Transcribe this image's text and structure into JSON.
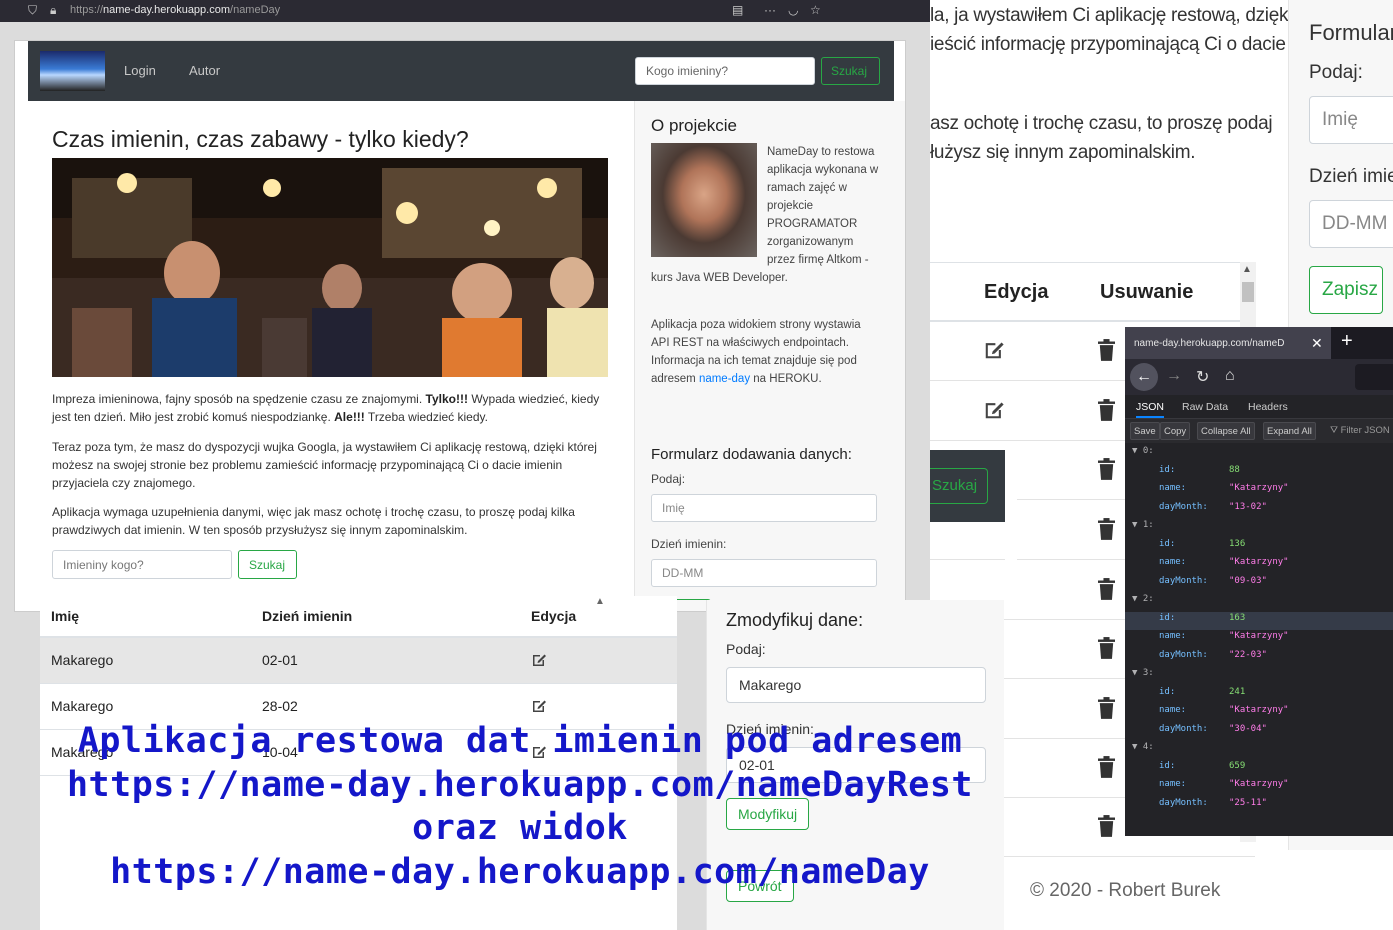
{
  "browser": {
    "url_prefix": "https://",
    "url_domain": "name-day.herokuapp.com",
    "url_path": "/nameDay",
    "icons": [
      "shield-icon",
      "lock-icon",
      "reader-icon",
      "more-icon",
      "pocket-icon",
      "bookmark-star-icon"
    ]
  },
  "navbar": {
    "links": [
      "Login",
      "Autor"
    ],
    "search_placeholder": "Kogo imieniny?",
    "search_button": "Szukaj"
  },
  "content": {
    "title": "Czas imienin, czas zabawy - tylko kiedy?",
    "p1_a": "Impreza imieninowa, fajny sposób na spędzenie czasu ze znajomymi. ",
    "p1_b": "Tylko!!!",
    "p1_c": " Wypada wiedzieć, kiedy jest ten dzień. Miło jest zrobić komuś niespodziankę. ",
    "p1_d": "Ale!!!",
    "p1_e": " Trzeba wiedzieć kiedy.",
    "p2": "Teraz poza tym, że masz do dyspozycji wujka Googla, ja wystawiłem Ci aplikację restową, dzięki której możesz na swojej stronie bez problemu zamieścić informację przypominającą Ci o dacie imienin przyjaciela czy znajomego.",
    "p3": "Aplikacja wymaga uzupełnienia danymi, więc jak masz ochotę i trochę czasu, to proszę podaj kilka prawdziwych dat imienin. W ten sposób przysłużysz się innym zapominalskim.",
    "search_placeholder": "Imieniny kogo?",
    "search_button": "Szukaj"
  },
  "sidebar": {
    "title": "O projekcie",
    "about": "NameDay to restowa aplikacja wykonana w ramach zajęć w projekcie PROGRAMATOR zorganizowanym przez firmę Altkom - kurs Java WEB Developer.",
    "api_text_a": "Aplikacja poza widokiem strony wystawia API REST na właściwych endpointach. Informacja na ich temat znajduje się pod adresem ",
    "api_link": "name-day",
    "api_text_b": " na HEROKU.",
    "form_title": "Formularz dodawania danych:",
    "label_name": "Podaj:",
    "name_placeholder": "Imię",
    "label_date": "Dzień imienin:",
    "date_placeholder": "DD-MM"
  },
  "table": {
    "headers": [
      "Imię",
      "Dzień imienin",
      "Edycja"
    ],
    "rows": [
      {
        "name": "Makarego",
        "date": "02-01"
      },
      {
        "name": "Makarego",
        "date": "28-02"
      },
      {
        "name": "Makarego",
        "date": "10-04"
      }
    ]
  },
  "modify": {
    "title": "Zmodyfikuj dane:",
    "label_name": "Podaj:",
    "name_value": "Makarego",
    "label_date": "Dzień imienin:",
    "date_value": "02-01",
    "submit": "Modyfikuj",
    "back": "Powrót"
  },
  "bg_right": {
    "line1": "la, ja wystawiłem Ci aplikację restową, dzięki",
    "line2": "ieścić informację przypominającą Ci o dacie",
    "line3": "asz ochotę i trochę czasu, to proszę podaj",
    "line4": "łużysz się innym zapominalskim.",
    "col_edit": "Edycja",
    "col_delete": "Usuwanie",
    "form_title": "Formularz",
    "label_name": "Podaj:",
    "name_placeholder": "Imię",
    "label_date": "Dzień imienin",
    "date_placeholder": "DD-MM",
    "save_button": "Zapisz",
    "frag_search": "Szukaj",
    "footer": "© 2020 - Robert Burek"
  },
  "json_viewer": {
    "tab_title": "name-day.herokuapp.com/nameD",
    "tabs": [
      "JSON",
      "Raw Data",
      "Headers"
    ],
    "tools": [
      "Save",
      "Copy",
      "Collapse All",
      "Expand All"
    ],
    "filter": "Filter JSON",
    "items": [
      {
        "index": "0:",
        "id": "88",
        "name": "\"Katarzyny\"",
        "dayMonth": "\"13-02\""
      },
      {
        "index": "1:",
        "id": "136",
        "name": "\"Katarzyny\"",
        "dayMonth": "\"09-03\""
      },
      {
        "index": "2:",
        "id": "163",
        "name": "\"Katarzyny\"",
        "dayMonth": "\"22-03\""
      },
      {
        "index": "3:",
        "id": "241",
        "name": "\"Katarzyny\"",
        "dayMonth": "\"30-04\""
      },
      {
        "index": "4:",
        "id": "659",
        "name": "\"Katarzyny\"",
        "dayMonth": "\"25-11\""
      }
    ],
    "key_id": "id:",
    "key_name": "name:",
    "key_daymonth": "dayMonth:"
  },
  "caption": {
    "line1": "Aplikacja restowa dat imienin pod adresem",
    "line2": "https://name-day.herokuapp.com/nameDayRest",
    "line3": "oraz widok",
    "line4": "https://name-day.herokuapp.com/nameDay"
  }
}
